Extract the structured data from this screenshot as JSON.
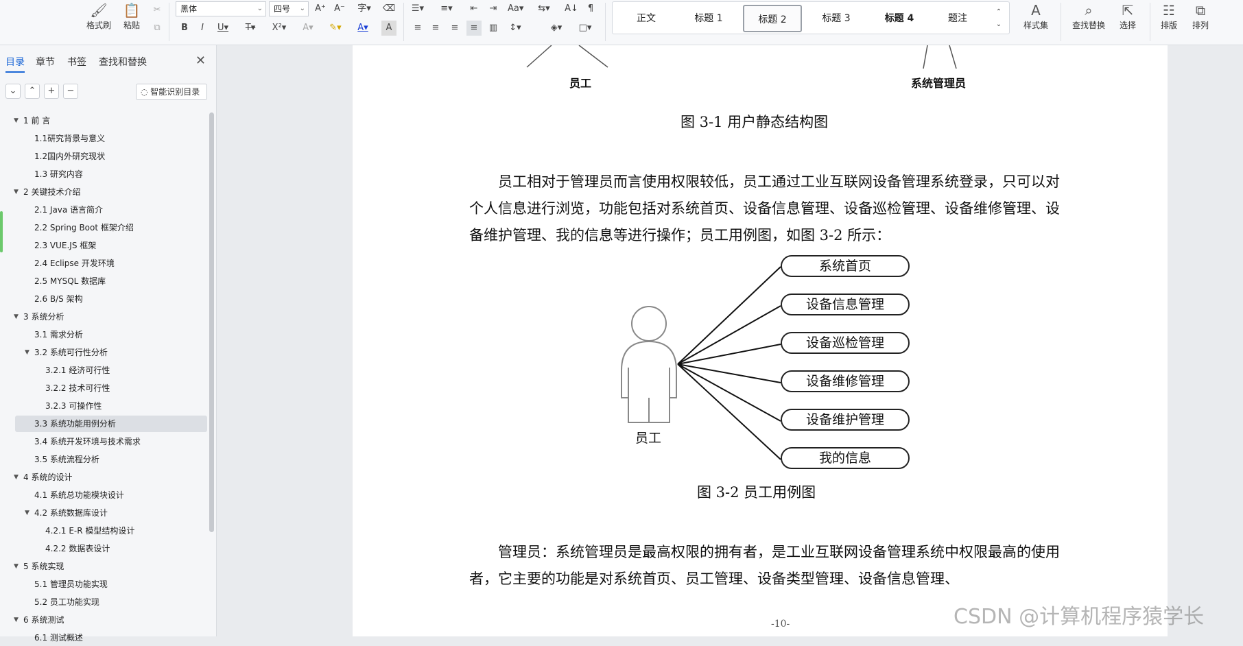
{
  "toolbar": {
    "format_painter": "格式刷",
    "paste": "粘贴",
    "font_name": "黑体",
    "font_size": "四号",
    "styles": [
      "正文",
      "标题 1",
      "标题 2",
      "标题 3",
      "标题 4",
      "题注"
    ],
    "active_style": "标题 2",
    "style_set": "样式集",
    "find_replace": "查找替换",
    "select": "选择",
    "layout": "排版",
    "arrange": "排列"
  },
  "sidebar": {
    "tabs": [
      "目录",
      "章节",
      "书签",
      "查找和替换"
    ],
    "smart_toc": "智能识别目录",
    "toc": [
      {
        "label": "1   前   言",
        "level": 1,
        "expanded": true
      },
      {
        "label": "1.1研究背景与意义",
        "level": 2
      },
      {
        "label": "1.2国内外研究现状",
        "level": 2
      },
      {
        "label": "1.3  研究内容",
        "level": 2
      },
      {
        "label": "2    关键技术介绍",
        "level": 1,
        "expanded": true
      },
      {
        "label": "2.1 Java 语言简介",
        "level": 2
      },
      {
        "label": "2.2 Spring Boot 框架介绍",
        "level": 2
      },
      {
        "label": "2.3 VUE.JS 框架",
        "level": 2
      },
      {
        "label": "2.4 Eclipse 开发环境",
        "level": 2
      },
      {
        "label": "2.5 MYSQL 数据库",
        "level": 2
      },
      {
        "label": "2.6 B/S 架构",
        "level": 2
      },
      {
        "label": "3    系统分析",
        "level": 1,
        "expanded": true
      },
      {
        "label": "3.1 需求分析",
        "level": 2
      },
      {
        "label": "3.2  系统可行性分析",
        "level": 2,
        "expanded": true
      },
      {
        "label": "3.2.1 经济可行性",
        "level": 3
      },
      {
        "label": "3.2.2 技术可行性",
        "level": 3
      },
      {
        "label": "3.2.3 可操作性",
        "level": 3
      },
      {
        "label": "3.3 系统功能用例分析",
        "level": 2,
        "selected": true
      },
      {
        "label": "3.4 系统开发环境与技术需求",
        "level": 2
      },
      {
        "label": "3.5 系统流程分析",
        "level": 2
      },
      {
        "label": "4    系统的设计",
        "level": 1,
        "expanded": true
      },
      {
        "label": "4.1 系统总功能模块设计",
        "level": 2
      },
      {
        "label": "4.2 系统数据库设计",
        "level": 2,
        "expanded": true
      },
      {
        "label": "4.2.1 E-R 模型结构设计",
        "level": 3
      },
      {
        "label": "4.2.2 数据表设计",
        "level": 3
      },
      {
        "label": "5 系统实现",
        "level": 1,
        "expanded": true
      },
      {
        "label": "5.1 管理员功能实现",
        "level": 2
      },
      {
        "label": "5.2 员工功能实现",
        "level": 2
      },
      {
        "label": "6 系统测试",
        "level": 1,
        "expanded": true
      },
      {
        "label": "6.1 测试概述",
        "level": 2
      }
    ]
  },
  "document": {
    "top_actor_left": "员工",
    "top_actor_right": "系统管理员",
    "fig1_caption": "图 3-1  用户静态结构图",
    "para1": "员工相对于管理员而言使用权限较低，员工通过工业互联网设备管理系统登录，只可以对个人信息进行浏览，功能包括对系统首页、设备信息管理、设备巡检管理、设备维修管理、设备维护管理、我的信息等进行操作；员工用例图，如图 3-2 所示：",
    "actor_label": "员工",
    "use_cases": [
      "系统首页",
      "设备信息管理",
      "设备巡检管理",
      "设备维修管理",
      "设备维护管理",
      "我的信息"
    ],
    "fig2_caption": "图 3-2  员工用例图",
    "para2": "管理员：系统管理员是最高权限的拥有者，是工业互联网设备管理系统中权限最高的使用者，它主要的功能是对系统首页、员工管理、设备类型管理、设备信息管理、",
    "page_number": "-10-"
  },
  "watermark": "CSDN @计算机程序猿学长"
}
